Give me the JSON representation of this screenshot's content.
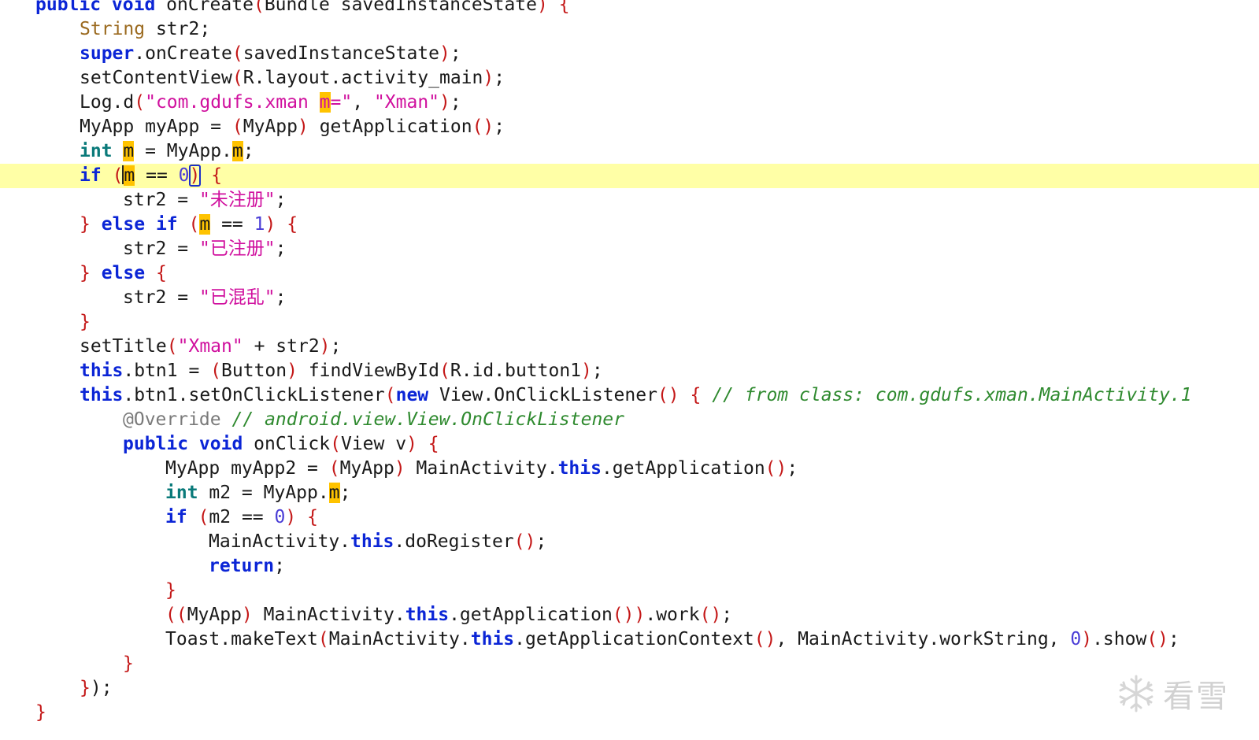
{
  "editor": {
    "lines": [
      {
        "indent": 45,
        "current": false,
        "tokens": [
          {
            "t": "public void ",
            "c": "kw"
          },
          {
            "t": "onCreate"
          },
          {
            "t": "(",
            "c": "paren"
          },
          {
            "t": "Bundle savedInstanceState"
          },
          {
            "t": ")",
            "c": "paren"
          },
          {
            "t": " "
          },
          {
            "t": "{",
            "c": "paren"
          }
        ]
      },
      {
        "indent": 101,
        "current": false,
        "tokens": [
          {
            "t": "String",
            "c": "type"
          },
          {
            "t": " str2;"
          }
        ]
      },
      {
        "indent": 101,
        "current": false,
        "tokens": [
          {
            "t": "super",
            "c": "kw"
          },
          {
            "t": ".onCreate"
          },
          {
            "t": "(",
            "c": "paren"
          },
          {
            "t": "savedInstanceState"
          },
          {
            "t": ")",
            "c": "paren"
          },
          {
            "t": ";"
          }
        ]
      },
      {
        "indent": 101,
        "current": false,
        "tokens": [
          {
            "t": "setContentView"
          },
          {
            "t": "(",
            "c": "paren"
          },
          {
            "t": "R.layout.activity_main"
          },
          {
            "t": ")",
            "c": "paren"
          },
          {
            "t": ";"
          }
        ]
      },
      {
        "indent": 101,
        "current": false,
        "tokens": [
          {
            "t": "Log.d"
          },
          {
            "t": "(",
            "c": "paren"
          },
          {
            "t": "\"com.gdufs.xman ",
            "c": "str"
          },
          {
            "t": "m",
            "c": "str hl"
          },
          {
            "t": "=\"",
            "c": "str"
          },
          {
            "t": ", "
          },
          {
            "t": "\"Xman\"",
            "c": "str"
          },
          {
            "t": ")",
            "c": "paren"
          },
          {
            "t": ";"
          }
        ]
      },
      {
        "indent": 101,
        "current": false,
        "tokens": [
          {
            "t": "MyApp myApp = "
          },
          {
            "t": "(",
            "c": "paren"
          },
          {
            "t": "MyApp"
          },
          {
            "t": ")",
            "c": "paren"
          },
          {
            "t": " getApplication"
          },
          {
            "t": "()",
            "c": "paren"
          },
          {
            "t": ";"
          }
        ]
      },
      {
        "indent": 101,
        "current": false,
        "tokens": [
          {
            "t": "int",
            "c": "kw2"
          },
          {
            "t": " "
          },
          {
            "t": "m",
            "c": "hl"
          },
          {
            "t": " = MyApp."
          },
          {
            "t": "m",
            "c": "hl"
          },
          {
            "t": ";"
          }
        ]
      },
      {
        "indent": 101,
        "current": true,
        "tokens": [
          {
            "t": "if",
            "c": "kw"
          },
          {
            "t": " "
          },
          {
            "t": "(",
            "c": "paren"
          },
          {
            "t": "",
            "c": "caret"
          },
          {
            "t": "m",
            "c": "hl"
          },
          {
            "t": " == "
          },
          {
            "t": "0",
            "c": "num"
          },
          {
            "t": ")",
            "c": "paren boxed"
          },
          {
            "t": " "
          },
          {
            "t": "{",
            "c": "paren"
          }
        ]
      },
      {
        "indent": 156,
        "current": false,
        "tokens": [
          {
            "t": "str2 = "
          },
          {
            "t": "\"未注册\"",
            "c": "str"
          },
          {
            "t": ";"
          }
        ]
      },
      {
        "indent": 101,
        "current": false,
        "tokens": [
          {
            "t": "}",
            "c": "paren"
          },
          {
            "t": " "
          },
          {
            "t": "else if",
            "c": "kw"
          },
          {
            "t": " "
          },
          {
            "t": "(",
            "c": "paren"
          },
          {
            "t": "m",
            "c": "hl"
          },
          {
            "t": " == "
          },
          {
            "t": "1",
            "c": "num"
          },
          {
            "t": ")",
            "c": "paren"
          },
          {
            "t": " "
          },
          {
            "t": "{",
            "c": "paren"
          }
        ]
      },
      {
        "indent": 156,
        "current": false,
        "tokens": [
          {
            "t": "str2 = "
          },
          {
            "t": "\"已注册\"",
            "c": "str"
          },
          {
            "t": ";"
          }
        ]
      },
      {
        "indent": 101,
        "current": false,
        "tokens": [
          {
            "t": "}",
            "c": "paren"
          },
          {
            "t": " "
          },
          {
            "t": "else",
            "c": "kw"
          },
          {
            "t": " "
          },
          {
            "t": "{",
            "c": "paren"
          }
        ]
      },
      {
        "indent": 156,
        "current": false,
        "tokens": [
          {
            "t": "str2 = "
          },
          {
            "t": "\"已混乱\"",
            "c": "str"
          },
          {
            "t": ";"
          }
        ]
      },
      {
        "indent": 101,
        "current": false,
        "tokens": [
          {
            "t": "}",
            "c": "paren"
          }
        ]
      },
      {
        "indent": 101,
        "current": false,
        "tokens": [
          {
            "t": "setTitle"
          },
          {
            "t": "(",
            "c": "paren"
          },
          {
            "t": "\"Xman\"",
            "c": "str"
          },
          {
            "t": " + str2"
          },
          {
            "t": ")",
            "c": "paren"
          },
          {
            "t": ";"
          }
        ]
      },
      {
        "indent": 101,
        "current": false,
        "tokens": [
          {
            "t": "this",
            "c": "kw"
          },
          {
            "t": ".btn1 = "
          },
          {
            "t": "(",
            "c": "paren"
          },
          {
            "t": "Button"
          },
          {
            "t": ")",
            "c": "paren"
          },
          {
            "t": " findViewById"
          },
          {
            "t": "(",
            "c": "paren"
          },
          {
            "t": "R.id.button1"
          },
          {
            "t": ")",
            "c": "paren"
          },
          {
            "t": ";"
          }
        ]
      },
      {
        "indent": 101,
        "current": false,
        "tokens": [
          {
            "t": "this",
            "c": "kw"
          },
          {
            "t": ".btn1.setOnClickListener"
          },
          {
            "t": "(",
            "c": "paren"
          },
          {
            "t": "new",
            "c": "kw"
          },
          {
            "t": " View.OnClickListener"
          },
          {
            "t": "()",
            "c": "paren"
          },
          {
            "t": " "
          },
          {
            "t": "{",
            "c": "paren"
          },
          {
            "t": " "
          },
          {
            "t": "// from class: com.gdufs.xman.MainActivity.1",
            "c": "cm"
          }
        ]
      },
      {
        "indent": 156,
        "current": false,
        "tokens": [
          {
            "t": "@Override",
            "c": "ann"
          },
          {
            "t": " "
          },
          {
            "t": "// android.view.View.OnClickListener",
            "c": "cm"
          }
        ]
      },
      {
        "indent": 156,
        "current": false,
        "tokens": [
          {
            "t": "public void",
            "c": "kw"
          },
          {
            "t": " onClick"
          },
          {
            "t": "(",
            "c": "paren"
          },
          {
            "t": "View v"
          },
          {
            "t": ")",
            "c": "paren"
          },
          {
            "t": " "
          },
          {
            "t": "{",
            "c": "paren"
          }
        ]
      },
      {
        "indent": 210,
        "current": false,
        "tokens": [
          {
            "t": "MyApp myApp2 = "
          },
          {
            "t": "(",
            "c": "paren"
          },
          {
            "t": "MyApp"
          },
          {
            "t": ")",
            "c": "paren"
          },
          {
            "t": " MainActivity."
          },
          {
            "t": "this",
            "c": "kw"
          },
          {
            "t": ".getApplication"
          },
          {
            "t": "()",
            "c": "paren"
          },
          {
            "t": ";"
          }
        ]
      },
      {
        "indent": 210,
        "current": false,
        "tokens": [
          {
            "t": "int",
            "c": "kw2"
          },
          {
            "t": " m2 = MyApp."
          },
          {
            "t": "m",
            "c": "hl"
          },
          {
            "t": ";"
          }
        ]
      },
      {
        "indent": 210,
        "current": false,
        "tokens": [
          {
            "t": "if",
            "c": "kw"
          },
          {
            "t": " "
          },
          {
            "t": "(",
            "c": "paren"
          },
          {
            "t": "m2 == "
          },
          {
            "t": "0",
            "c": "num"
          },
          {
            "t": ")",
            "c": "paren"
          },
          {
            "t": " "
          },
          {
            "t": "{",
            "c": "paren"
          }
        ]
      },
      {
        "indent": 265,
        "current": false,
        "tokens": [
          {
            "t": "MainActivity."
          },
          {
            "t": "this",
            "c": "kw"
          },
          {
            "t": ".doRegister"
          },
          {
            "t": "()",
            "c": "paren"
          },
          {
            "t": ";"
          }
        ]
      },
      {
        "indent": 265,
        "current": false,
        "tokens": [
          {
            "t": "return",
            "c": "kw"
          },
          {
            "t": ";"
          }
        ]
      },
      {
        "indent": 210,
        "current": false,
        "tokens": [
          {
            "t": "}",
            "c": "paren"
          }
        ]
      },
      {
        "indent": 210,
        "current": false,
        "tokens": [
          {
            "t": "((",
            "c": "paren"
          },
          {
            "t": "MyApp"
          },
          {
            "t": ")",
            "c": "paren"
          },
          {
            "t": " MainActivity."
          },
          {
            "t": "this",
            "c": "kw"
          },
          {
            "t": ".getApplication"
          },
          {
            "t": "())",
            "c": "paren"
          },
          {
            "t": ".work"
          },
          {
            "t": "()",
            "c": "paren"
          },
          {
            "t": ";"
          }
        ]
      },
      {
        "indent": 210,
        "current": false,
        "tokens": [
          {
            "t": "Toast.makeText"
          },
          {
            "t": "(",
            "c": "paren"
          },
          {
            "t": "MainActivity."
          },
          {
            "t": "this",
            "c": "kw"
          },
          {
            "t": ".getApplicationContext"
          },
          {
            "t": "()",
            "c": "paren"
          },
          {
            "t": ", MainActivity.workString, "
          },
          {
            "t": "0",
            "c": "num"
          },
          {
            "t": ")",
            "c": "paren"
          },
          {
            "t": ".show"
          },
          {
            "t": "()",
            "c": "paren"
          },
          {
            "t": ";"
          }
        ]
      },
      {
        "indent": 156,
        "current": false,
        "tokens": [
          {
            "t": "}",
            "c": "paren"
          }
        ]
      },
      {
        "indent": 101,
        "current": false,
        "tokens": [
          {
            "t": "}",
            "c": "paren"
          },
          {
            "t": ");"
          }
        ]
      },
      {
        "indent": 45,
        "current": false,
        "tokens": [
          {
            "t": "}",
            "c": "paren"
          }
        ]
      }
    ]
  },
  "watermark": {
    "icon": "snowflake-icon",
    "text": "看雪"
  }
}
